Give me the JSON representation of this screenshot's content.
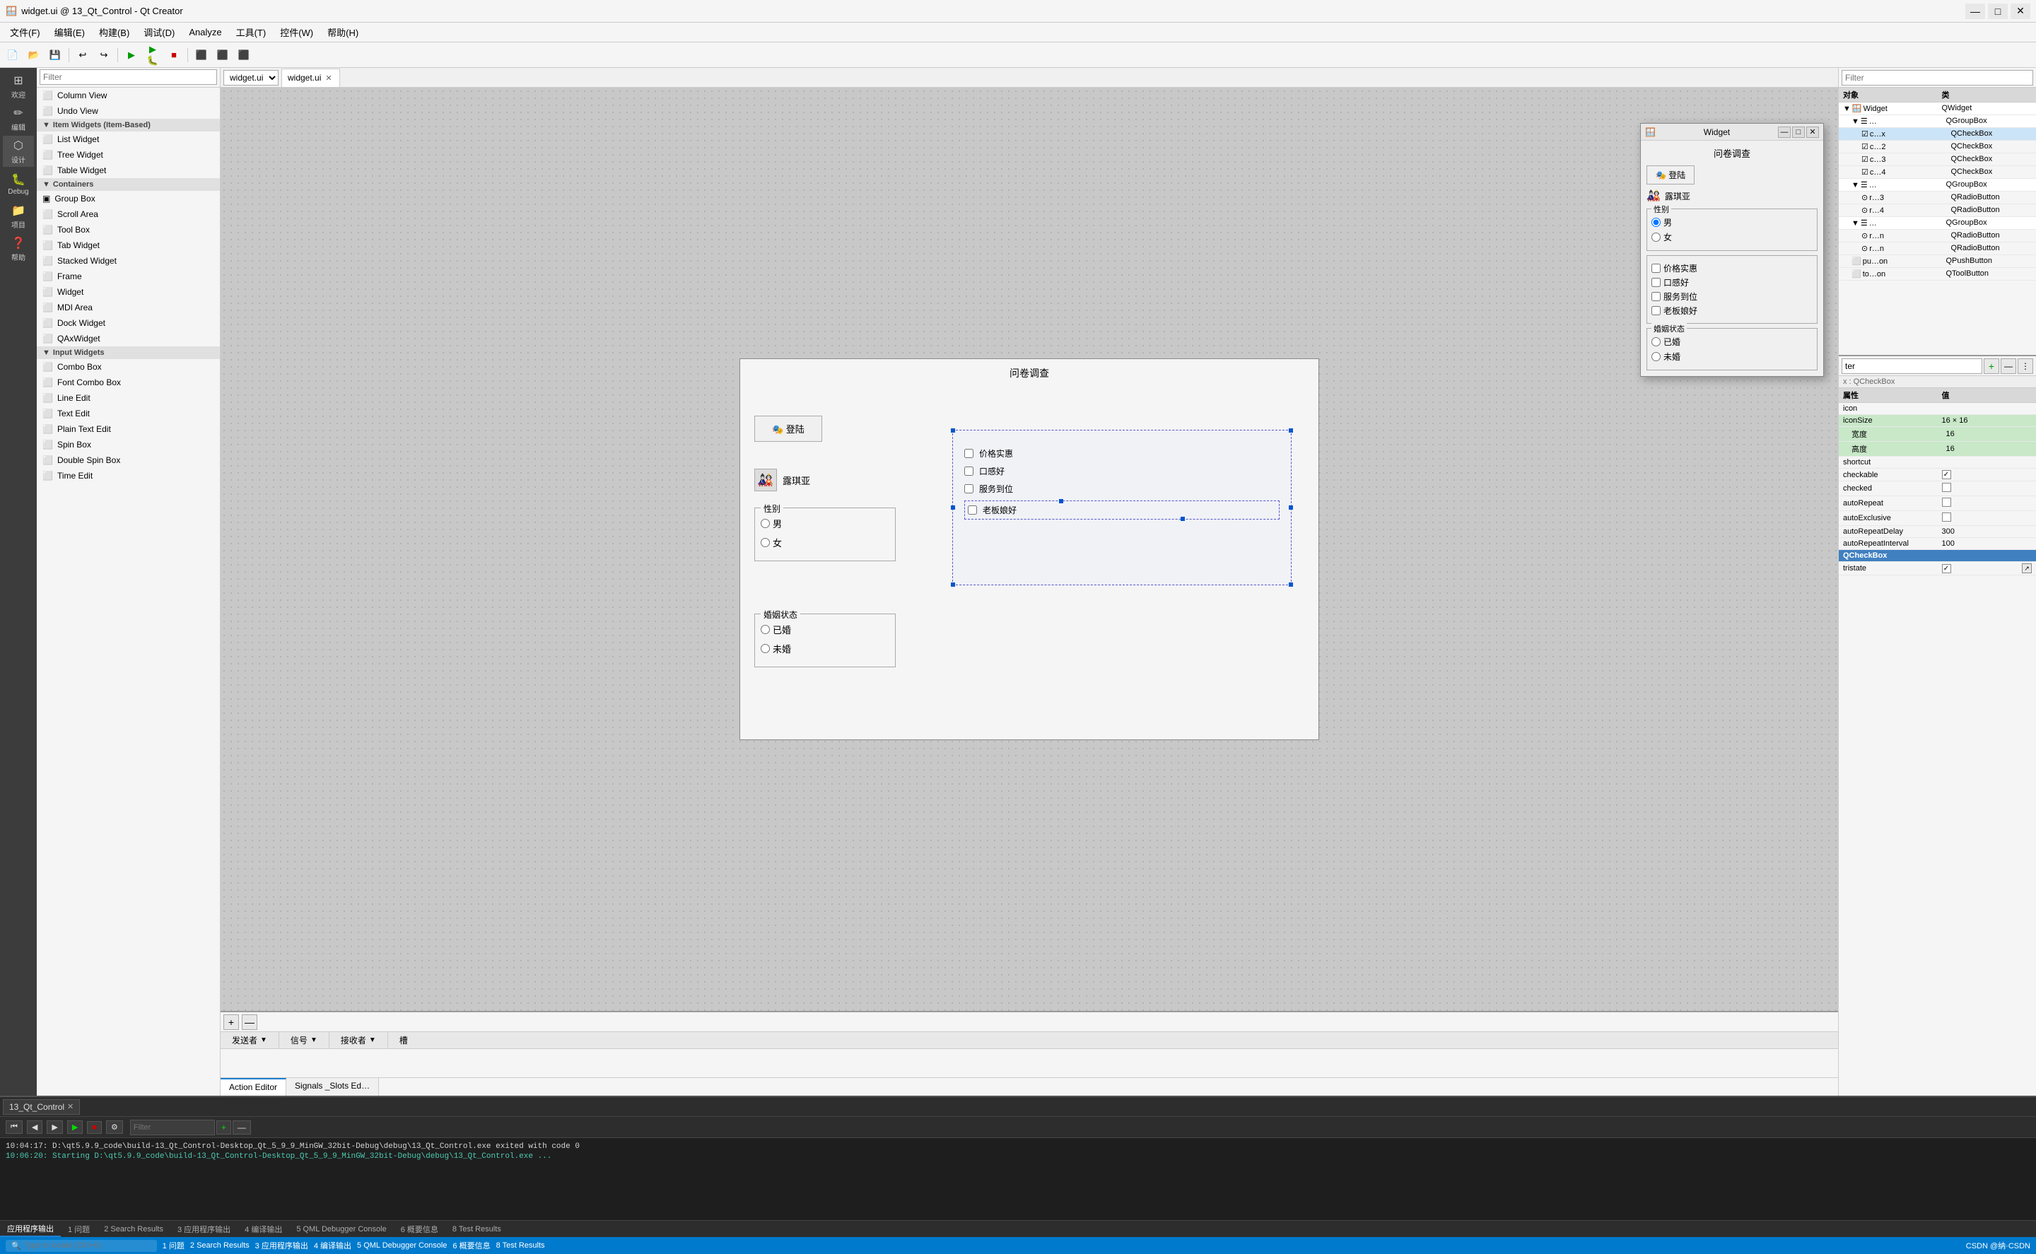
{
  "titleBar": {
    "icon": "🪟",
    "title": "widget.ui @ 13_Qt_Control - Qt Creator",
    "minBtn": "—",
    "maxBtn": "□",
    "closeBtn": "✕"
  },
  "menuBar": {
    "items": [
      {
        "label": "文件(F)"
      },
      {
        "label": "编辑(E)"
      },
      {
        "label": "构建(B)"
      },
      {
        "label": "调试(D)"
      },
      {
        "label": "Analyze"
      },
      {
        "label": "工具(T)"
      },
      {
        "label": "控件(W)"
      },
      {
        "label": "帮助(H)"
      }
    ]
  },
  "activityBar": {
    "items": [
      {
        "icon": "⊞",
        "label": "欢迎"
      },
      {
        "icon": "✏",
        "label": "编辑"
      },
      {
        "icon": "⬡",
        "label": "设计"
      },
      {
        "icon": "🐛",
        "label": "Debug"
      },
      {
        "icon": "📁",
        "label": "项目"
      },
      {
        "icon": "❓",
        "label": "帮助"
      }
    ]
  },
  "widgetPanel": {
    "filterPlaceholder": "Filter",
    "sections": [
      {
        "label": "Containers",
        "items": [
          {
            "icon": "▣",
            "label": "Group Box"
          },
          {
            "icon": "⬜",
            "label": "Scroll Area"
          },
          {
            "icon": "⬜",
            "label": "Tool Box"
          },
          {
            "icon": "⬜",
            "label": "Tab Widget"
          },
          {
            "icon": "⬜",
            "label": "Stacked Widget"
          },
          {
            "icon": "⬜",
            "label": "Frame"
          },
          {
            "icon": "⬜",
            "label": "Widget"
          },
          {
            "icon": "⬜",
            "label": "MDI Area"
          },
          {
            "icon": "⬜",
            "label": "Dock Widget"
          },
          {
            "icon": "⬜",
            "label": "QAxWidget"
          }
        ]
      },
      {
        "label": "Input Widgets",
        "items": [
          {
            "icon": "⬜",
            "label": "Combo Box"
          },
          {
            "icon": "⬜",
            "label": "Font Combo Box"
          },
          {
            "icon": "⬜",
            "label": "Line Edit"
          },
          {
            "icon": "⬜",
            "label": "Text Edit"
          },
          {
            "icon": "⬜",
            "label": "Plain Text Edit"
          },
          {
            "icon": "⬜",
            "label": "Spin Box"
          },
          {
            "icon": "⬜",
            "label": "Double Spin Box"
          },
          {
            "icon": "⬜",
            "label": "Time Edit"
          }
        ]
      }
    ],
    "topItems": [
      {
        "icon": "⬜",
        "label": "Column View"
      },
      {
        "icon": "⬜",
        "label": "Undo View"
      }
    ],
    "itemWidgetsSection": {
      "label": "Item Widgets (Item-Based)",
      "items": [
        {
          "icon": "⬜",
          "label": "List Widget"
        },
        {
          "icon": "⬜",
          "label": "Tree Widget"
        },
        {
          "icon": "⬜",
          "label": "Table Widget"
        }
      ]
    }
  },
  "canvasTab": {
    "filename": "widget.ui",
    "closeIcon": "✕"
  },
  "designCanvas": {
    "title": "问卷调查",
    "loginBtn": "🎭 登陆",
    "avatarName": "露琪亚",
    "genderLabel": "性别",
    "genderOptions": [
      "男",
      "女"
    ],
    "maritalLabel": "婚姻状态",
    "maritalOptions": [
      "已婚",
      "未婚"
    ],
    "checkboxes": [
      "价格实惠",
      "口感好",
      "服务到位",
      "老板娘好"
    ]
  },
  "objectInspector": {
    "filterPlaceholder": "Filter",
    "col1": "对象",
    "col2": "类",
    "rows": [
      {
        "indent": 0,
        "expand": "▼",
        "obj": "Widget",
        "cls": "QWidget",
        "selected": false
      },
      {
        "indent": 1,
        "expand": "▼",
        "obj": "…",
        "cls": "QGroupBox",
        "selected": false
      },
      {
        "indent": 2,
        "expand": "",
        "obj": "c…x",
        "cls": "QCheckBox",
        "selected": false
      },
      {
        "indent": 2,
        "expand": "",
        "obj": "c…2",
        "cls": "QCheckBox",
        "selected": false
      },
      {
        "indent": 2,
        "expand": "",
        "obj": "c…3",
        "cls": "QCheckBox",
        "selected": false
      },
      {
        "indent": 2,
        "expand": "",
        "obj": "c…4",
        "cls": "QCheckBox",
        "selected": false
      },
      {
        "indent": 1,
        "expand": "▼",
        "obj": "…",
        "cls": "QGroupBox",
        "selected": false
      },
      {
        "indent": 2,
        "expand": "",
        "obj": "r…3",
        "cls": "QRadioButton",
        "selected": false
      },
      {
        "indent": 2,
        "expand": "",
        "obj": "r…4",
        "cls": "QRadioButton",
        "selected": false
      },
      {
        "indent": 1,
        "expand": "▼",
        "obj": "…",
        "cls": "QGroupBox",
        "selected": false
      },
      {
        "indent": 2,
        "expand": "",
        "obj": "r…n",
        "cls": "QRadioButton",
        "selected": false
      },
      {
        "indent": 2,
        "expand": "",
        "obj": "r…n",
        "cls": "QRadioButton",
        "selected": false
      },
      {
        "indent": 1,
        "expand": "",
        "obj": "pu…on",
        "cls": "QPushButton",
        "selected": false
      },
      {
        "indent": 1,
        "expand": "",
        "obj": "to…on",
        "cls": "QToolButton",
        "selected": false
      }
    ]
  },
  "propertyPanel": {
    "filterPlaceholder": "ter",
    "typeLabel": "x : QCheckBox",
    "addBtn": "+",
    "removeBtn": "—",
    "moreBtn": "⋮",
    "col1": "属性",
    "col2": "值",
    "rows": [
      {
        "name": "icon",
        "value": "",
        "type": "text",
        "green": false
      },
      {
        "name": "iconSize",
        "value": "16 × 16",
        "type": "text",
        "green": true
      },
      {
        "name": "宽度",
        "value": "16",
        "type": "text",
        "green": true
      },
      {
        "name": "高度",
        "value": "16",
        "type": "text",
        "green": true
      },
      {
        "name": "shortcut",
        "value": "",
        "type": "text",
        "green": false
      },
      {
        "name": "checkable",
        "value": "✓",
        "type": "check",
        "green": false
      },
      {
        "name": "checked",
        "value": "",
        "type": "check",
        "green": false
      },
      {
        "name": "autoRepeat",
        "value": "",
        "type": "check",
        "green": false
      },
      {
        "name": "autoExclusive",
        "value": "",
        "type": "check",
        "green": false
      },
      {
        "name": "autoRepeatDelay",
        "value": "300",
        "type": "text",
        "green": false
      },
      {
        "name": "autoRepeatInterval",
        "value": "100",
        "type": "text",
        "green": false
      },
      {
        "name": "QCheckBox",
        "value": "",
        "type": "section",
        "green": false,
        "selected": true
      },
      {
        "name": "tristate",
        "value": "✓",
        "type": "check-btn",
        "green": false
      }
    ]
  },
  "bottomPanel": {
    "addBtn": "+",
    "removeBtn": "—",
    "columns": [
      "发送者",
      "信号",
      "接收者",
      "槽"
    ],
    "tabs": [
      {
        "label": "Action Editor",
        "active": false
      },
      {
        "label": "Signals _Slots Ed…",
        "active": false
      }
    ]
  },
  "outputPanel": {
    "filterPlaceholder": "Filter",
    "tabs": [
      {
        "label": "应用程序输出",
        "active": true
      },
      {
        "label": "1 问题"
      },
      {
        "label": "2 Search Results"
      },
      {
        "label": "3 应用程序输出"
      },
      {
        "label": "4 编译输出"
      },
      {
        "label": "5 QML Debugger Console"
      },
      {
        "label": "6 概要信息"
      },
      {
        "label": "8 Test Results"
      }
    ],
    "line1": "10:04:17: D:\\qt5.9.9_code\\build-13_Qt_Control-Desktop_Qt_5_9_9_MinGW_32bit-Debug\\debug\\13_Qt_Control.exe exited with code 0",
    "line2": "10:06:20: Starting D:\\qt5.9.9_code\\build-13_Qt_Control-Desktop_Qt_5_9_9_MinGW_32bit-Debug\\debug\\13_Qt_Control.exe ..."
  },
  "fileTab": {
    "runTab": "13_Qt_Control",
    "closeBtn": "✕"
  },
  "statusBar": {
    "leftItems": [
      "🔍 Type to locate (Ctrl+K)"
    ],
    "rightText": "CSDN @纳·CSDN"
  },
  "floatingWindow": {
    "icon": "🪟",
    "title": "Widget",
    "minBtn": "—",
    "maxBtn": "□",
    "closeBtn": "✕",
    "content": {
      "title": "问卷调查",
      "loginBtn": "🎭 登陆",
      "avatarName": "露琪亚",
      "genderLabel": "性别",
      "genderOptions": [
        "男",
        "女"
      ],
      "genderSelected": "男",
      "maritalLabel": "婚姻状态",
      "maritalOptions": [
        "已婚",
        "未婚"
      ],
      "checkboxes": [
        "价格实惠",
        "口感好",
        "服务到位",
        "老板娘好"
      ]
    }
  }
}
